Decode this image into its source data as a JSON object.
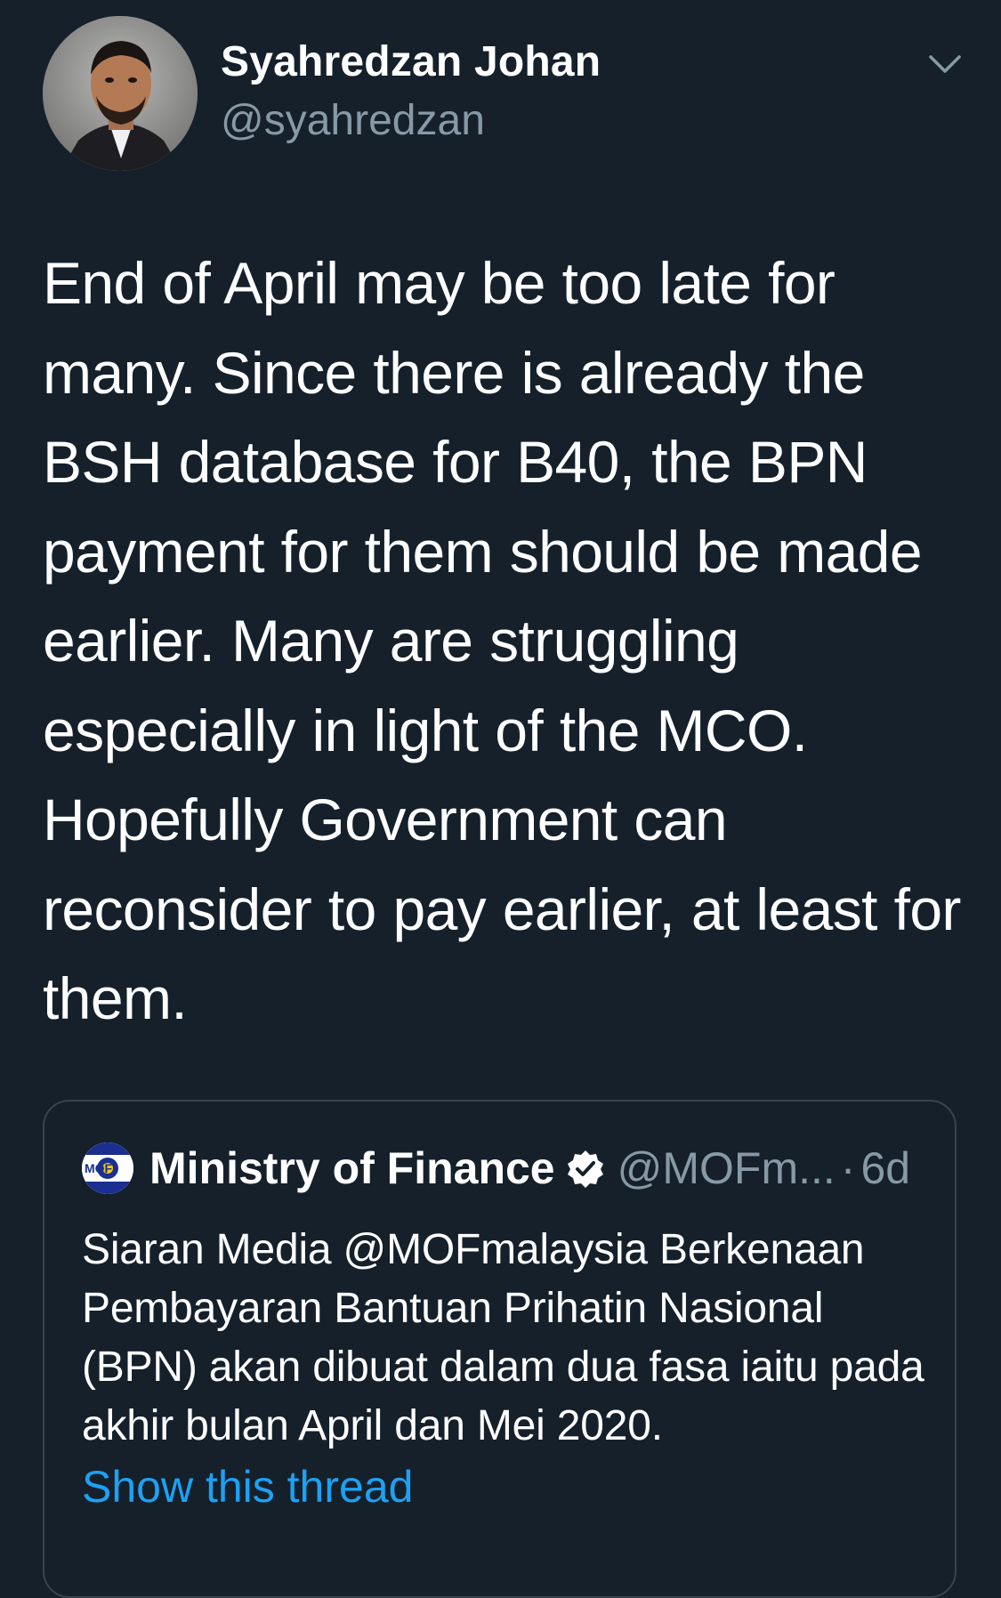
{
  "author": {
    "name": "Syahredzan Johan",
    "handle": "@syahredzan"
  },
  "tweet": {
    "text": "End of April may be too late for many. Since there is already the BSH database for B40, the BPN payment for them should be made earlier. Many are struggling especially in light of the MCO. Hopefully Government can reconsider to pay earlier, at least for them."
  },
  "quoted_tweet": {
    "name": "Ministry of Finance",
    "handle": "@MOFm...",
    "separator": "·",
    "time": "6d",
    "avatar_logo_text": "MOF",
    "text": "Siaran Media @MOFmalaysia Berkenaan Pembayaran Bantuan Prihatin Nasional (BPN) akan dibuat dalam dua fasa iaitu pada akhir bulan April dan Mei 2020.",
    "show_thread_label": "Show this thread"
  },
  "colors": {
    "background": "#15202b",
    "text_primary": "#ffffff",
    "text_secondary": "#8899a6",
    "link": "#1da1f2",
    "border": "#38444d"
  },
  "icons": {
    "menu": "chevron-down-icon",
    "verified": "verified-badge-icon"
  }
}
